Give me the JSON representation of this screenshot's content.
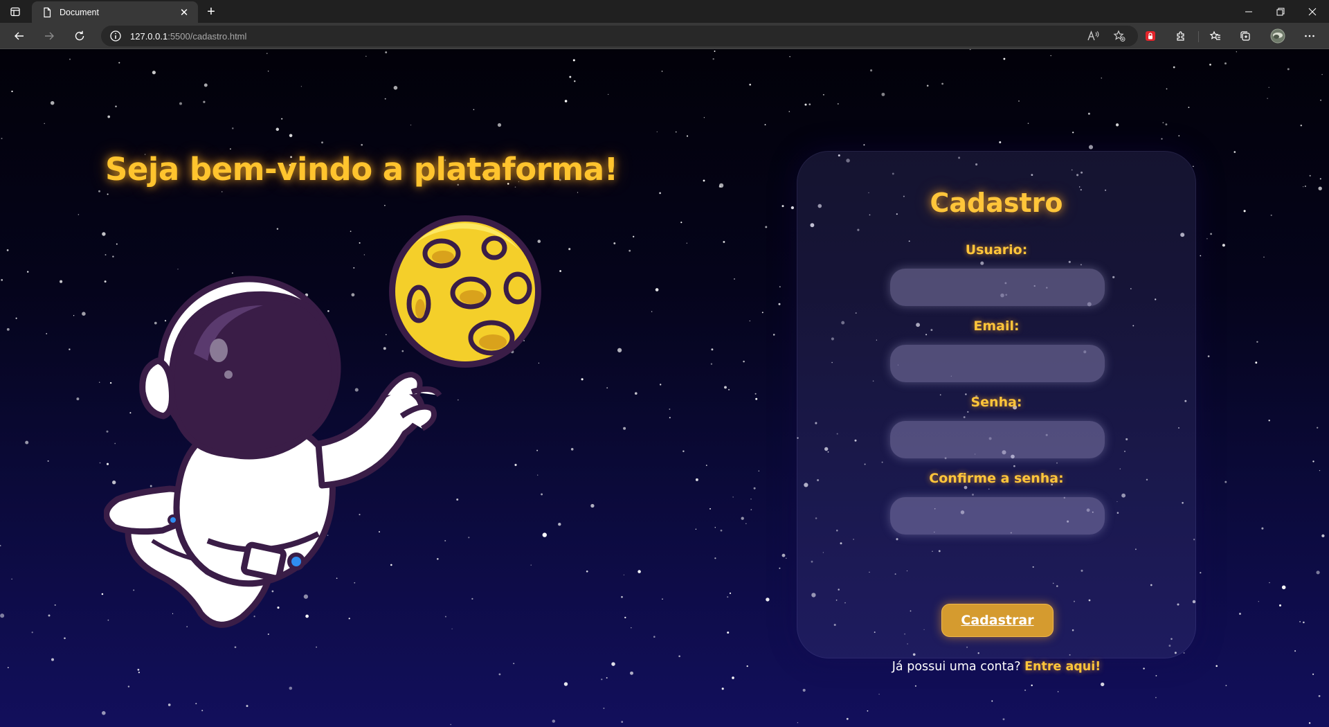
{
  "browser": {
    "tab_title": "Document",
    "url_host": "127.0.0.1",
    "url_path": ":5500/cadastro.html",
    "new_tab_label": "+",
    "close_tab_label": "✕"
  },
  "hero": {
    "title": "Seja bem-vindo a plataforma!",
    "illustration": "astronaut-reaching-moon"
  },
  "form": {
    "title": "Cadastro",
    "fields": [
      {
        "label": "Usuario:",
        "value": "",
        "type": "text"
      },
      {
        "label": "Email:",
        "value": "",
        "type": "email"
      },
      {
        "label": "Senha:",
        "value": "",
        "type": "password"
      },
      {
        "label": "Confirme a senha:",
        "value": "",
        "type": "password"
      }
    ],
    "submit_label": "Cadastrar",
    "signin_question": "Já possui uma conta?",
    "signin_link": "Entre aqui!"
  },
  "colors": {
    "accent": "#ffc53a",
    "button": "#d59b2f",
    "background_top": "#020109",
    "background_bottom": "#120f5c"
  }
}
